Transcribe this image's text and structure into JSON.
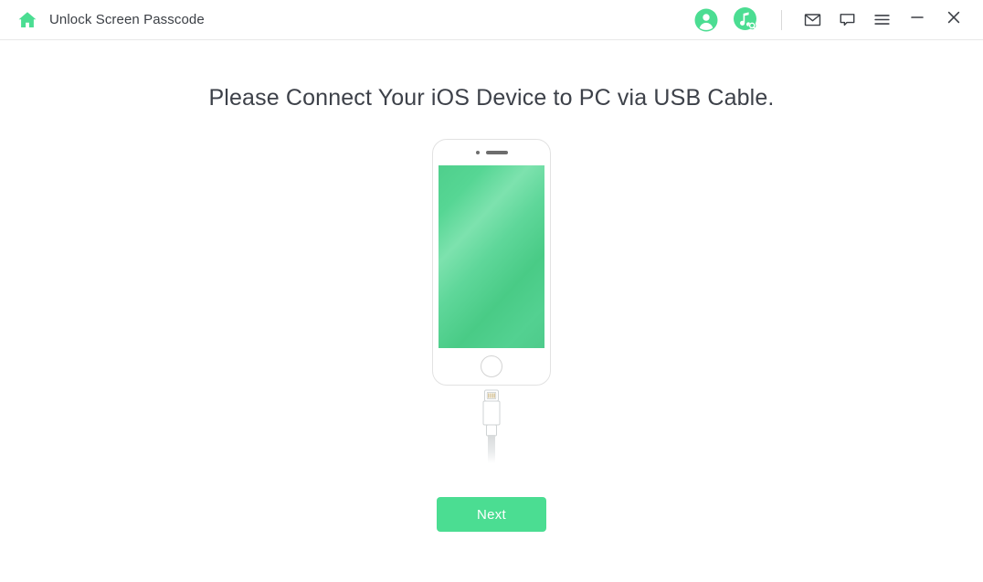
{
  "window": {
    "title": "Unlock Screen Passcode",
    "home_icon": "home-icon",
    "accent_color": "#4bdd92",
    "titlebar_background": "#ffffff",
    "content_background": "#ffffff"
  },
  "titlebar_actions": [
    {
      "name": "account-icon",
      "label": "Account",
      "type": "green-circle"
    },
    {
      "name": "music-search-icon",
      "label": "Music Search",
      "type": "green-circle"
    },
    {
      "name": "mail-icon",
      "label": "Mail",
      "type": "outline"
    },
    {
      "name": "feedback-icon",
      "label": "Feedback",
      "type": "outline"
    },
    {
      "name": "menu-icon",
      "label": "Menu",
      "type": "outline"
    }
  ],
  "window_controls": [
    {
      "name": "minimize-button",
      "label": "Minimize",
      "glyph": "–"
    },
    {
      "name": "close-button",
      "label": "Close",
      "glyph": "✕"
    }
  ],
  "main": {
    "headline": "Please Connect Your iOS Device to PC via USB Cable.",
    "illustration": {
      "device": "iphone-illustration",
      "screen_gradient_from": "#4fcf8c",
      "screen_gradient_to": "#4ecb8b",
      "cable": "lightning-cable-illustration",
      "cable_pin_color": "#c8b47a"
    },
    "next_label": "Next"
  }
}
